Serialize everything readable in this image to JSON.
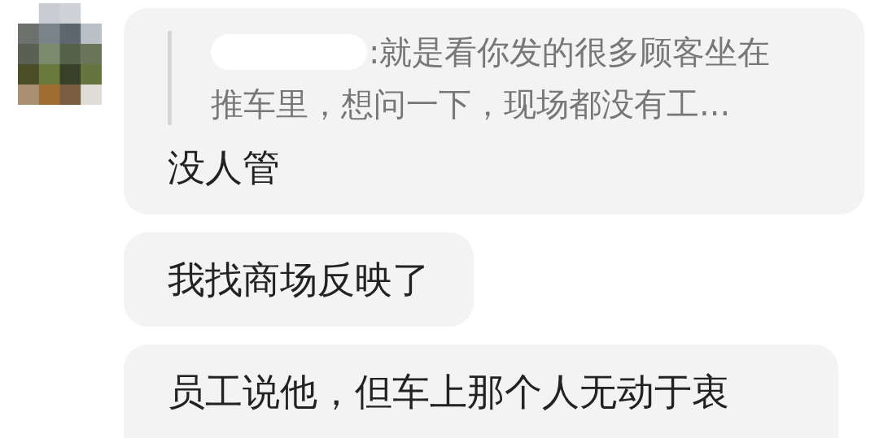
{
  "messages": [
    {
      "quote": {
        "lines": [
          ":就是看你发的很多顾客坐在",
          "推车里，想问一下，现场都没有工..."
        ]
      },
      "text": "没人管"
    },
    {
      "text": "我找商场反映了"
    },
    {
      "text": "员工说他，但车上那个人无动于衷"
    }
  ]
}
